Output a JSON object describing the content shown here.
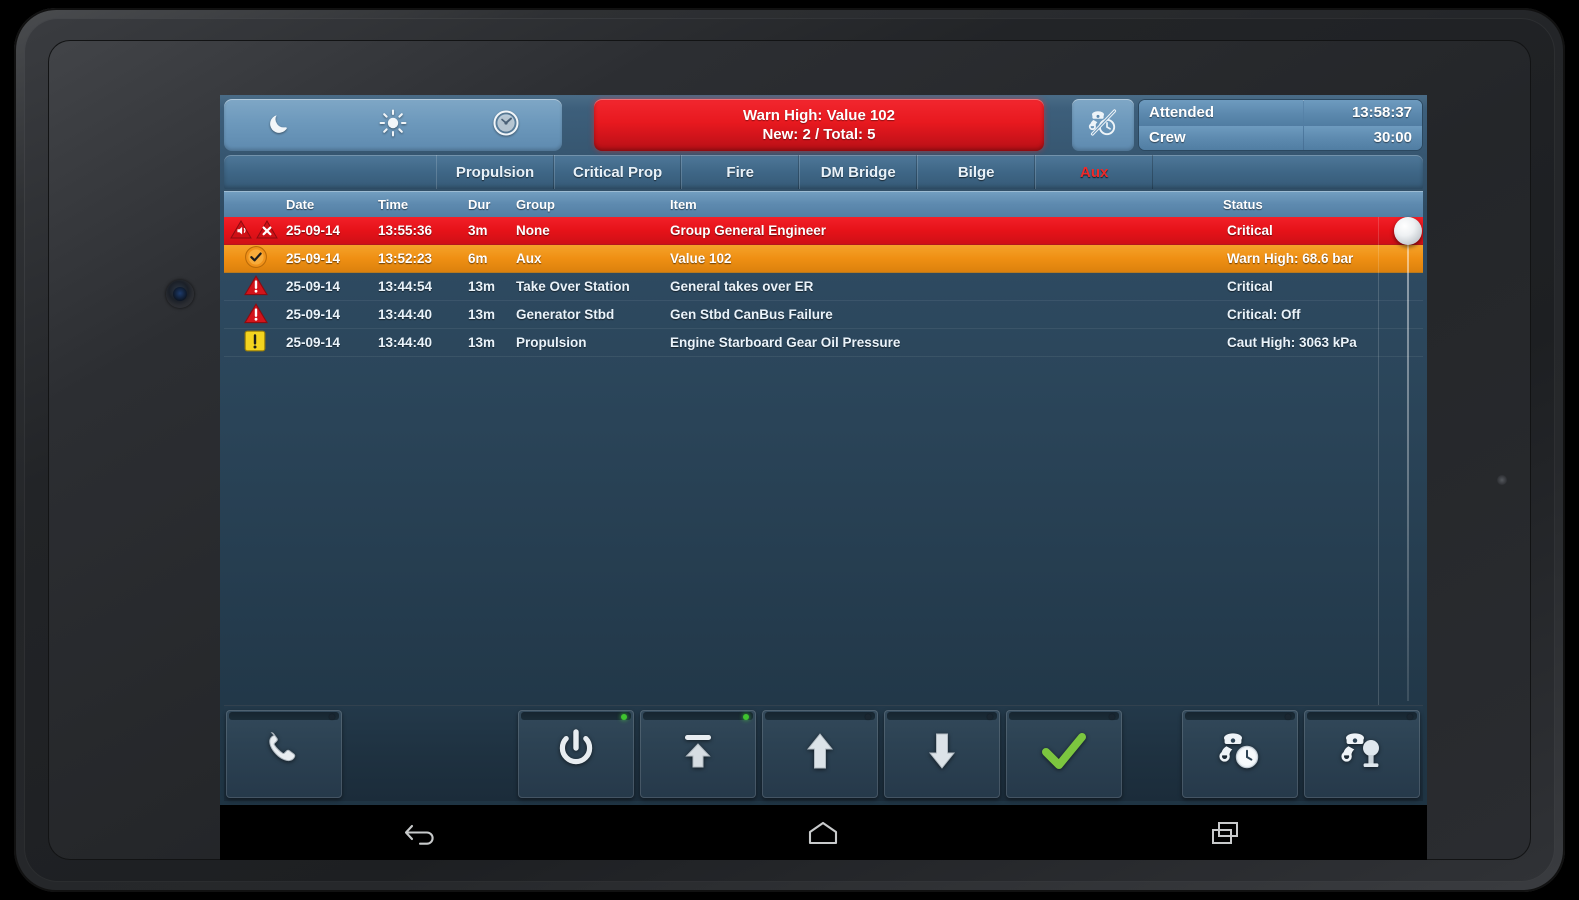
{
  "device": {
    "name": "android-tablet",
    "nav": {
      "back": "back-icon",
      "home": "home-icon",
      "recents": "recent-apps-icon"
    }
  },
  "topbar": {
    "mode_buttons": [
      {
        "name": "night-mode",
        "icon": "moon-icon"
      },
      {
        "name": "day-mode",
        "icon": "sun-icon"
      },
      {
        "name": "dimmer",
        "icon": "gauge-icon"
      }
    ],
    "alarm_banner": {
      "line1": "Warn High: Value 102",
      "line2": "New: 2 / Total: 5",
      "new_count": 2,
      "total_count": 5,
      "color": "#e61219"
    },
    "duty_icon": "crew-watch-disabled-icon",
    "status": {
      "attended_label": "Attended",
      "attended_value": "13:58:37",
      "crew_label": "Crew",
      "crew_value": "30:00"
    }
  },
  "tabs": [
    {
      "label": "Propulsion",
      "active": false
    },
    {
      "label": "Critical Prop",
      "active": false
    },
    {
      "label": "Fire",
      "active": false
    },
    {
      "label": "DM Bridge",
      "active": false
    },
    {
      "label": "Bilge",
      "active": false
    },
    {
      "label": "Aux",
      "active": true
    }
  ],
  "table": {
    "columns": [
      "",
      "Date",
      "Time",
      "Dur",
      "Group",
      "Item",
      "Status"
    ],
    "headers": {
      "date": "Date",
      "time": "Time",
      "dur": "Dur",
      "group": "Group",
      "item": "Item",
      "status": "Status"
    },
    "rows": [
      {
        "icons": [
          "muted-alarm-icon",
          "cancel-alarm-icon"
        ],
        "date": "25-09-14",
        "time": "13:55:36",
        "dur": "3m",
        "group": "None",
        "item": "Group General Engineer",
        "status": "Critical",
        "severity": "critical"
      },
      {
        "icons": [
          "acknowledged-icon"
        ],
        "date": "25-09-14",
        "time": "13:52:23",
        "dur": "6m",
        "group": "Aux",
        "item": "Value 102",
        "status": "Warn High: 68.6 bar",
        "severity": "warning"
      },
      {
        "icons": [
          "critical-alarm-icon"
        ],
        "date": "25-09-14",
        "time": "13:44:54",
        "dur": "13m",
        "group": "Take Over Station",
        "item": "General takes over ER",
        "status": "Critical",
        "severity": "normal"
      },
      {
        "icons": [
          "critical-alarm-icon"
        ],
        "date": "25-09-14",
        "time": "13:44:40",
        "dur": "13m",
        "group": "Generator Stbd",
        "item": "Gen Stbd CanBus Failure",
        "status": "Critical: Off",
        "severity": "normal"
      },
      {
        "icons": [
          "caution-alarm-icon"
        ],
        "date": "25-09-14",
        "time": "13:44:40",
        "dur": "13m",
        "group": "Propulsion",
        "item": "Engine Starboard Gear Oil Pressure",
        "status": "Caut High: 3063 kPa",
        "severity": "normal"
      }
    ]
  },
  "toolbar": {
    "buttons": [
      {
        "name": "call-button",
        "icon": "phone-icon",
        "led": "off"
      },
      {
        "name": "power-button",
        "icon": "power-icon",
        "led": "on"
      },
      {
        "name": "jump-to-top-button",
        "icon": "arrow-to-top-icon",
        "led": "on"
      },
      {
        "name": "scroll-up-button",
        "icon": "arrow-up-icon",
        "led": "off"
      },
      {
        "name": "scroll-down-button",
        "icon": "arrow-down-icon",
        "led": "off"
      },
      {
        "name": "acknowledge-button",
        "icon": "check-icon",
        "led": "off"
      },
      {
        "name": "watch-timer-button",
        "icon": "crew-clock-icon",
        "led": "off"
      },
      {
        "name": "crew-call-button",
        "icon": "crew-lamp-icon",
        "led": "off"
      }
    ]
  },
  "colors": {
    "critical": "#e61219",
    "warning": "#ef8f13",
    "caution": "#f2d024",
    "accent_blue": "#5e8aaf",
    "background_top": "#36556e",
    "background_bottom": "#1f3443",
    "ok_green": "#7ac943"
  }
}
